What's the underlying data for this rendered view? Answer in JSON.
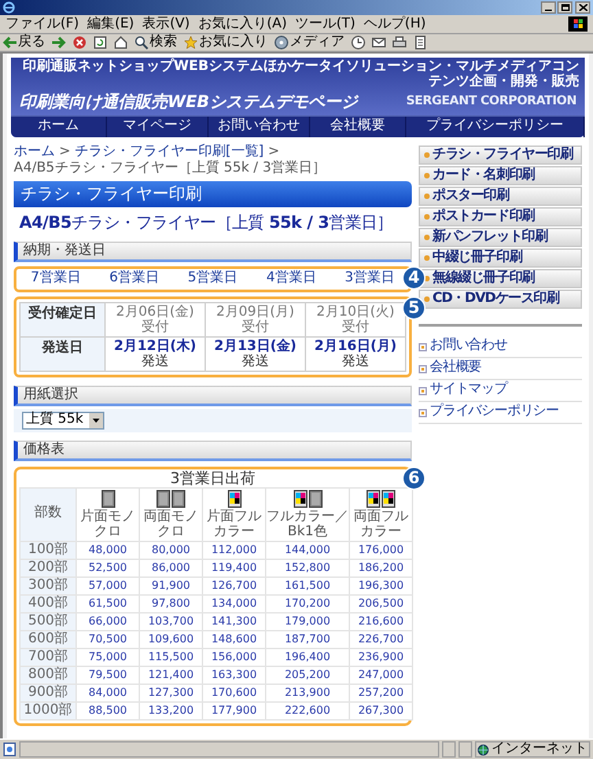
{
  "window": {
    "menu": [
      "ファイル(F)",
      "編集(E)",
      "表示(V)",
      "お気に入り(A)",
      "ツール(T)",
      "ヘルプ(H)"
    ],
    "toolbar": [
      {
        "kind": "back",
        "label": "戻る"
      },
      {
        "kind": "forward"
      },
      {
        "kind": "stop"
      },
      {
        "kind": "refresh"
      },
      {
        "kind": "home"
      },
      {
        "kind": "search",
        "label": "検索"
      },
      {
        "kind": "favorites",
        "label": "お気に入り"
      },
      {
        "kind": "media",
        "label": "メディア"
      },
      {
        "kind": "history"
      },
      {
        "kind": "mail"
      },
      {
        "kind": "print"
      },
      {
        "kind": "edit"
      }
    ]
  },
  "header": {
    "tagline": "印刷通販ネットショップWEBシステムほかケータイソリューション・マルチメディアコンテンツ企画・開発・販売",
    "title": "印刷業向け通信販売WEBシステムデモページ",
    "company": "SERGEANT CORPORATION"
  },
  "nav": [
    "ホーム",
    "マイページ",
    "お問い合わせ",
    "会社概要",
    "プライバシーポリシー"
  ],
  "breadcrumb": [
    {
      "kind": "link",
      "text": "ホーム"
    },
    {
      "kind": "separator",
      "text": ">"
    },
    {
      "kind": "link",
      "text": "チラシ・フライヤー印刷[一覧]"
    },
    {
      "kind": "separator",
      "text": ">"
    },
    {
      "kind": "current",
      "text": "A4/B5チラシ・フライヤー［上質 55k / 3営業日］"
    }
  ],
  "category_title": "チラシ・フライヤー印刷",
  "product_title": "**A4/B5**チラシ・フライヤー［上質 **55k / 3**営業日］",
  "delivery": {
    "heading": "納期・発送日",
    "callout": "4",
    "days": [
      "7営業日",
      "6営業日",
      "5営業日",
      "4営業日",
      "3営業日"
    ]
  },
  "schedule": {
    "callout": "5",
    "rows": [
      {
        "kind": "order",
        "label": "受付確定日",
        "cells": [
          {
            "date": "2月06日(金)",
            "note": "受付"
          },
          {
            "date": "2月09日(月)",
            "note": "受付"
          },
          {
            "date": "2月10日(火)",
            "note": "受付"
          }
        ]
      },
      {
        "kind": "ship",
        "label": "発送日",
        "cells": [
          {
            "date": "2月12日(木)",
            "note": "発送"
          },
          {
            "date": "2月13日(金)",
            "note": "発送"
          },
          {
            "date": "2月16日(月)",
            "note": "発送"
          }
        ]
      }
    ]
  },
  "paper": {
    "heading": "用紙選択",
    "value": "上質 55k"
  },
  "prices": {
    "heading": "価格表",
    "callout": "6",
    "caption": "3営業日出荷",
    "corner": "部数",
    "columns": [
      {
        "label": "片面モノクロ",
        "pages": [
          {
            "kind": "mono"
          }
        ]
      },
      {
        "label": "両面モノクロ",
        "pages": [
          {
            "kind": "mono"
          },
          {
            "kind": "mono"
          }
        ]
      },
      {
        "label": "片面フルカラー",
        "pages": [
          {
            "kind": "color"
          }
        ]
      },
      {
        "label": "フルカラー／Bk1色",
        "pages": [
          {
            "kind": "color"
          },
          {
            "kind": "mono"
          }
        ]
      },
      {
        "label": "両面フルカラー",
        "pages": [
          {
            "kind": "color"
          },
          {
            "kind": "color"
          }
        ]
      }
    ],
    "rows": [
      {
        "qty": "100部",
        "values": [
          "48,000",
          "80,000",
          "112,000",
          "144,000",
          "176,000"
        ]
      },
      {
        "qty": "200部",
        "values": [
          "52,500",
          "86,000",
          "119,400",
          "152,800",
          "186,200"
        ]
      },
      {
        "qty": "300部",
        "values": [
          "57,000",
          "91,900",
          "126,700",
          "161,500",
          "196,300"
        ]
      },
      {
        "qty": "400部",
        "values": [
          "61,500",
          "97,800",
          "134,000",
          "170,200",
          "206,500"
        ]
      },
      {
        "qty": "500部",
        "values": [
          "66,000",
          "103,700",
          "141,300",
          "179,000",
          "216,600"
        ]
      },
      {
        "qty": "600部",
        "values": [
          "70,500",
          "109,600",
          "148,600",
          "187,700",
          "226,700"
        ]
      },
      {
        "qty": "700部",
        "values": [
          "75,000",
          "115,500",
          "156,000",
          "196,400",
          "236,900"
        ]
      },
      {
        "qty": "800部",
        "values": [
          "79,500",
          "121,400",
          "163,300",
          "205,200",
          "247,000"
        ]
      },
      {
        "qty": "900部",
        "values": [
          "84,000",
          "127,300",
          "170,600",
          "213,900",
          "257,200"
        ]
      },
      {
        "qty": "1000部",
        "values": [
          "88,500",
          "133,200",
          "177,900",
          "222,600",
          "267,300"
        ]
      }
    ]
  },
  "sidebar": {
    "products": [
      "チラシ・フライヤー印刷",
      "カード・名刺印刷",
      "ポスター印刷",
      "ポストカード印刷",
      "新パンフレット印刷",
      "中綴じ冊子印刷",
      "無線綴じ冊子印刷",
      "CD・DVDケース印刷"
    ],
    "links": [
      "お問い合わせ",
      "会社概要",
      "サイトマップ",
      "プライバシーポリシー"
    ]
  },
  "status_bar": {
    "zone": "インターネット"
  }
}
